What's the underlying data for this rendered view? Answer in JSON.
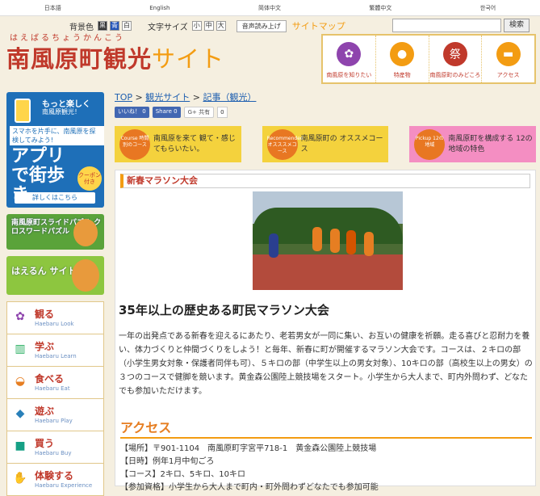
{
  "languages": [
    "日本語",
    "English",
    "简体中文",
    "繁體中文",
    "한국어"
  ],
  "toolbar": {
    "bg_label": "背景色",
    "bg_opts": [
      "黒",
      "青",
      "白"
    ],
    "font_label": "文字サイズ",
    "font_opts": [
      "小",
      "中",
      "大"
    ],
    "speech": "音声読み上げ",
    "sitemap": "サイトマップ",
    "search_btn": "検索"
  },
  "header": {
    "ruby": "はえばるちょうかんこう",
    "logo_main": "南風原町観光",
    "logo_site": "サイト"
  },
  "nav": [
    {
      "label": "南風原を知りたい",
      "icon": "flower-icon",
      "color": "#8e44ad"
    },
    {
      "label": "特産物",
      "icon": "pumpkin-icon",
      "color": "#f39c12"
    },
    {
      "label": "南風原町のみどころ",
      "icon": "lantern-icon",
      "color": "#c0392b"
    },
    {
      "label": "アクセス",
      "icon": "car-icon",
      "color": "#f39c12"
    }
  ],
  "sidebar": {
    "b1_t1": "もっと楽しく",
    "b1_t2": "南風原観光！",
    "b1_t3": "スマホを片手に、南風原を探検してみよう!",
    "b1_t4": "アプリで街歩き",
    "b1_coupon": "クーポン付き",
    "b1_more": "詳しくはこちら",
    "b2": "南風原町スライドパズル クロスワードパズル",
    "b3": "はえるん サイト",
    "menu": [
      {
        "jp": "観る",
        "en": "Haebaru Look",
        "icon": "flower-icon"
      },
      {
        "jp": "学ぶ",
        "en": "Haebaru Learn",
        "icon": "books-icon"
      },
      {
        "jp": "食べる",
        "en": "Haebaru Eat",
        "icon": "bowl-icon"
      },
      {
        "jp": "遊ぶ",
        "en": "Haebaru Play",
        "icon": "play-icon"
      },
      {
        "jp": "買う",
        "en": "Haebaru Buy",
        "icon": "bag-icon"
      },
      {
        "jp": "体験する",
        "en": "Haebaru Experience",
        "icon": "hand-icon"
      }
    ]
  },
  "breadcrumb": {
    "top": "TOP",
    "sep": ">",
    "site": "観光サイト",
    "article": "記事（観光）"
  },
  "social": {
    "like": "いいね！",
    "like_count": "0",
    "share": "Share",
    "share_count": "0",
    "gplus": "共有",
    "gplus_count": "0"
  },
  "cards": [
    {
      "tag": "Course 時間別のコース",
      "title": "南風原を来て 観て・感じてもらいたい。"
    },
    {
      "tag": "Recommended オスススメコース",
      "title": "南風原町の オススメコース"
    },
    {
      "tag": "Pickup 12の地域",
      "title": "南風原町を構成する 12の地域の特色"
    }
  ],
  "article": {
    "section_title": "新春マラソン大会",
    "heading": "35年以上の歴史ある町民マラソン大会",
    "body": "一年の出発点である新春を迎えるにあたり、老若男女が一同に集い、お互いの健康を祈願。走る喜びと忍耐力を養い、体力づくりと仲間づくりをしよう！と毎年、新春に町が開催するマラソン大会です。コースは、２キロの部（小学生男女対象・保護者同伴も可）、５キロの部（中学生以上の男女対象）、10キロの部（高校生以上の男女）の３つのコースで健脚を競います。黄金森公園陸上競技場をスタート。小学生から大人まで、町内外問わず、どなたでも参加いただけます。",
    "access_title": "アクセス",
    "info": [
      "【場所】〒901-1104　南風原町字宮平718-1　黄金森公園陸上競技場",
      "【日時】例年1月中旬ごろ",
      "【コース】2キロ、5キロ、10キロ",
      "【参加資格】小学生から大人まで町内・町外問わずどなたでも参加可能"
    ]
  }
}
